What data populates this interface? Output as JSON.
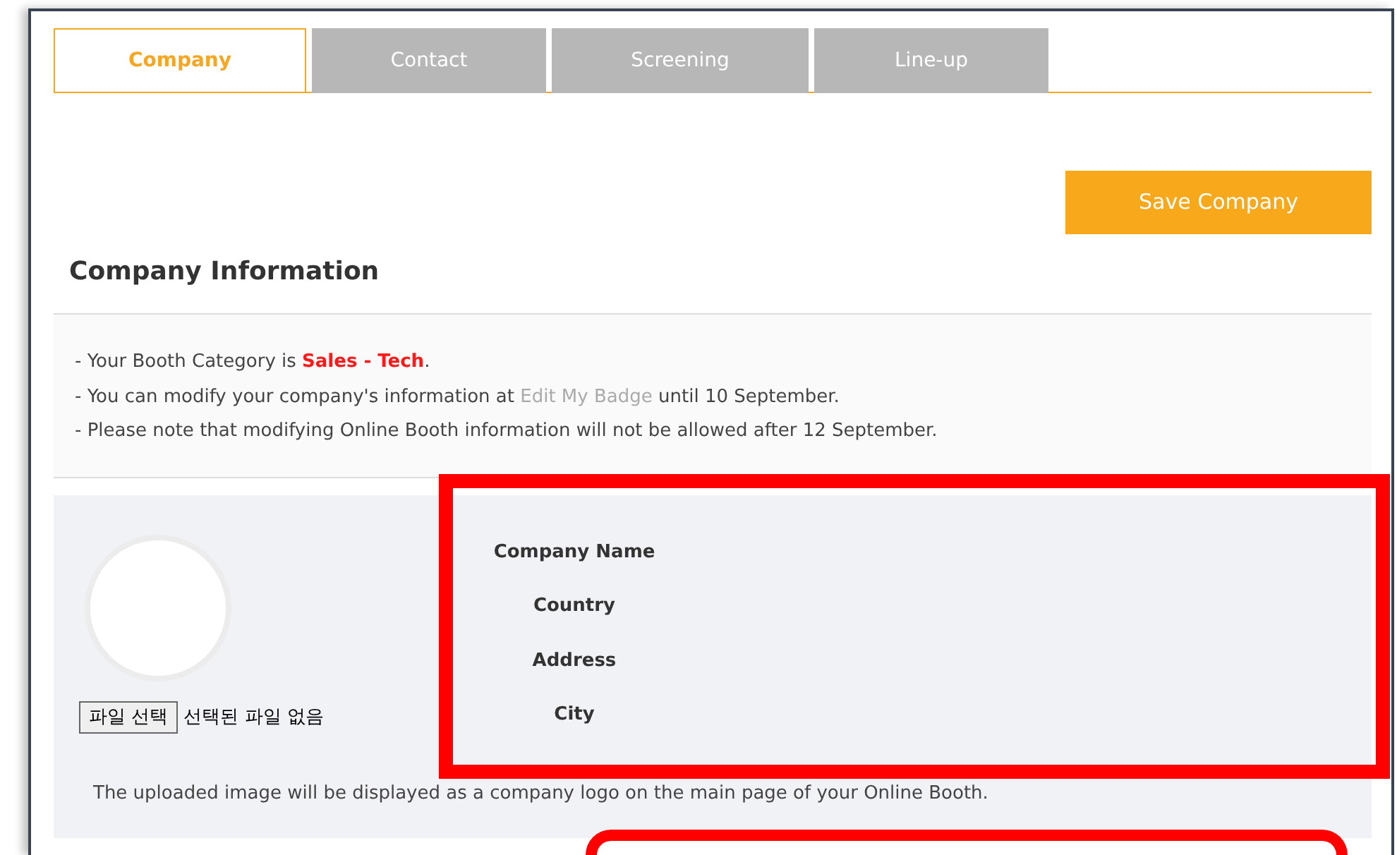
{
  "tabs": [
    {
      "label": "Company",
      "selected": true
    },
    {
      "label": "Contact",
      "selected": false
    },
    {
      "label": "Screening",
      "selected": false
    },
    {
      "label": "Line-up",
      "selected": false
    }
  ],
  "save_button": "Save Company",
  "section_title": "Company Information",
  "notices": [
    [
      {
        "kind": "plain",
        "text": "- Your Booth Category is "
      },
      {
        "kind": "highlight",
        "text": "Sales - Tech"
      },
      {
        "kind": "plain",
        "text": "."
      }
    ],
    [
      {
        "kind": "plain",
        "text": "- You can modify your company's information at "
      },
      {
        "kind": "link",
        "text": "Edit My Badge"
      },
      {
        "kind": "plain",
        "text": " until 10 September."
      }
    ],
    [
      {
        "kind": "plain",
        "text": "- Please note that modifying Online Booth information will not be allowed after 12 September."
      }
    ]
  ],
  "logo_upload": {
    "button": "파일 선택",
    "status": "선택된 파일 없음",
    "note": "The uploaded image will be displayed as a company logo on the main page of your Online Booth."
  },
  "fields": [
    {
      "label": "Company Name"
    },
    {
      "label": "Country"
    },
    {
      "label": "Address"
    },
    {
      "label": "City"
    }
  ],
  "annotations": [
    {
      "kind": "rect"
    },
    {
      "kind": "rounded"
    }
  ]
}
